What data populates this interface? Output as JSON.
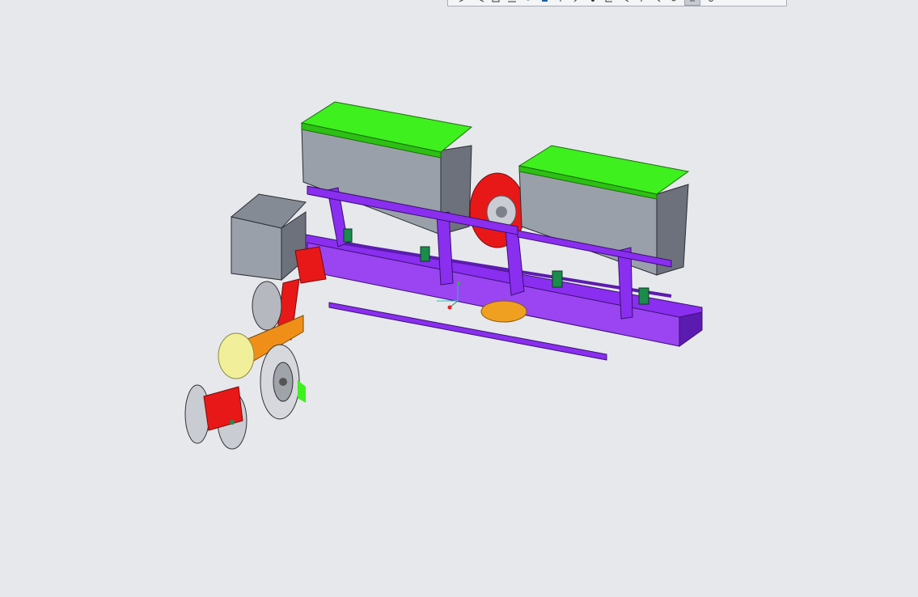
{
  "viewport": {
    "background": "#e6e8ec",
    "model": {
      "colors": {
        "hopper_body": "#9aa0aa",
        "hopper_lid": "#3ef01e",
        "frame": "#8a2ef0",
        "frame_dark": "#5c1bb0",
        "drive_wheel": "#e81818",
        "gear": "#f0a020",
        "clamp": "#1a8c4c",
        "press_wheel": "#b5b8bf",
        "orange_bracket": "#f08f18"
      }
    }
  },
  "view_toolbar": {
    "buttons": [
      {
        "icon": "zoom-in-icon"
      },
      {
        "icon": "zoom-out-icon"
      },
      {
        "icon": "refit-icon"
      },
      {
        "icon": "reorient-icon"
      },
      {
        "icon": "saved-views-icon"
      },
      {
        "icon": "display-style-icon"
      },
      {
        "icon": "datum-planes-icon"
      },
      {
        "icon": "datum-axes-icon"
      },
      {
        "icon": "datum-points-icon"
      },
      {
        "icon": "csys-icon"
      },
      {
        "icon": "annotations-icon"
      },
      {
        "icon": "spin-center-icon"
      },
      {
        "icon": "view-manager-icon"
      },
      {
        "icon": "section-icon"
      },
      {
        "icon": "perspective-icon"
      },
      {
        "icon": "appearance-icon"
      }
    ]
  }
}
